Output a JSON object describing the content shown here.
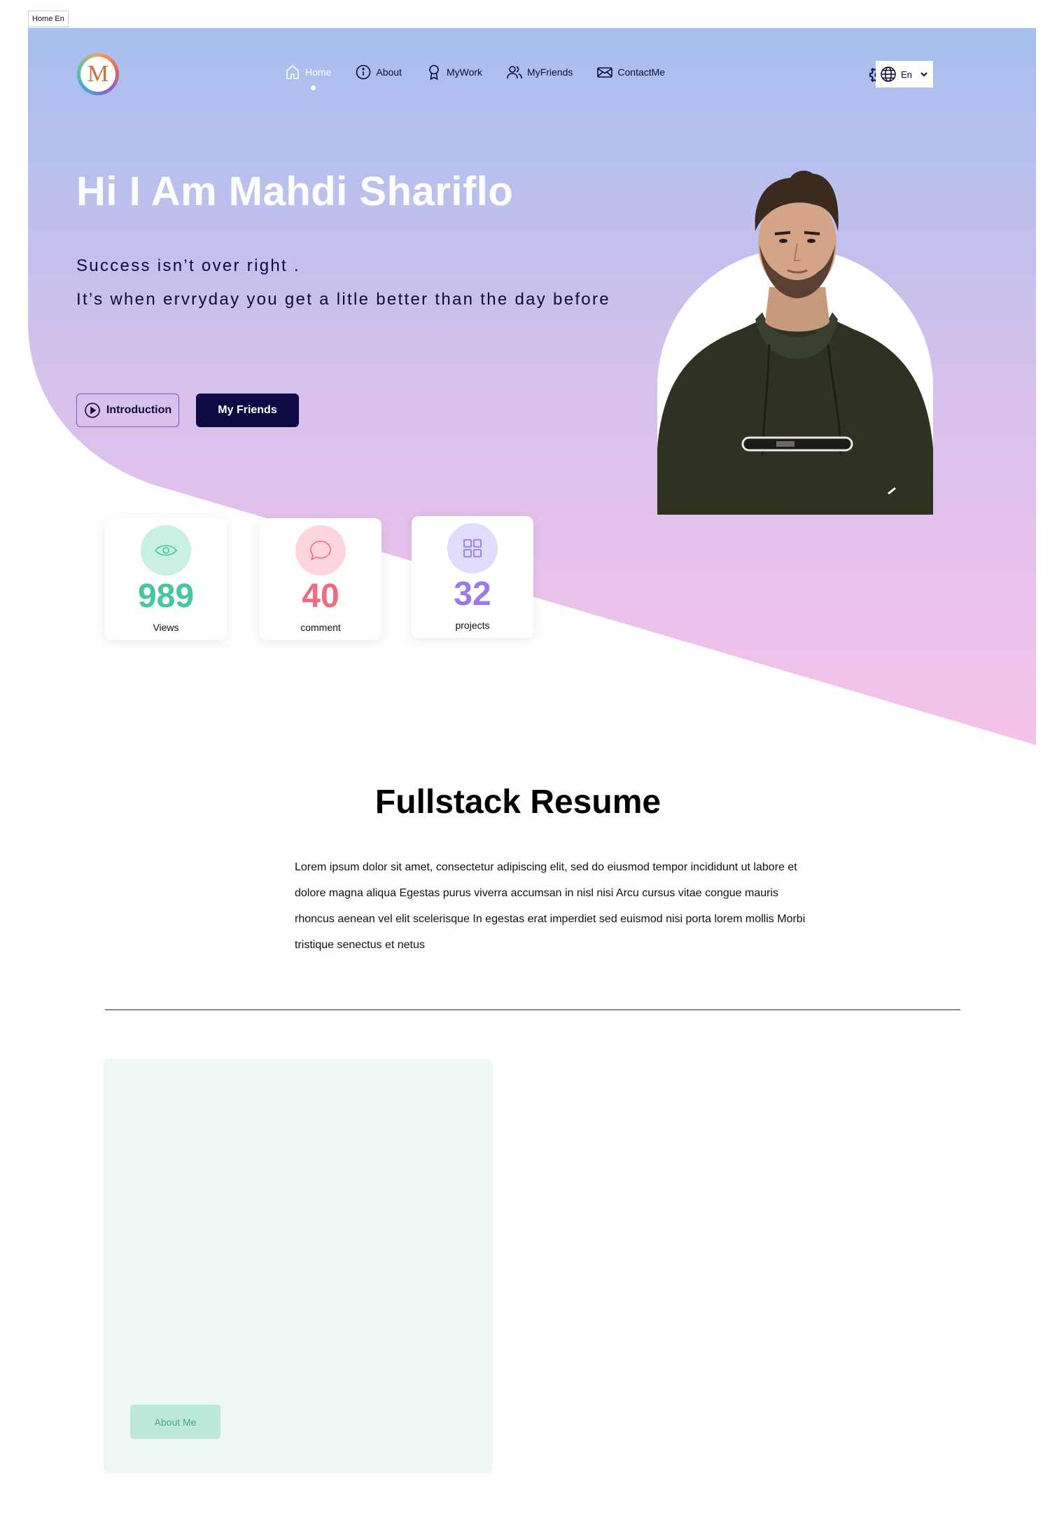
{
  "browser_tab": {
    "label": "Home En"
  },
  "header": {
    "logo_letter": "M",
    "nav": [
      {
        "label": "Home",
        "icon": "home-icon",
        "active": true
      },
      {
        "label": "About",
        "icon": "info-icon",
        "active": false
      },
      {
        "label": "MyWork",
        "icon": "award-icon",
        "active": false
      },
      {
        "label": "MyFriends",
        "icon": "users-icon",
        "active": false
      },
      {
        "label": "ContactMe",
        "icon": "mail-icon",
        "active": false
      }
    ],
    "settings_icon": "gear-icon",
    "language": {
      "value": "En",
      "icon": "globe-icon"
    }
  },
  "hero": {
    "title": "Hi I Am Mahdi Shariflo",
    "tagline_1": "Success isn’t over right .",
    "tagline_2": "It’s when ervryday you get a litle better than the day before",
    "intro_button": "Introduction",
    "friends_button": "My Friends",
    "colors": {
      "gradient_top": "#a6bfee",
      "gradient_mid": "#d6c1ec",
      "gradient_bottom": "#f6c2ea",
      "dark": "#0e0942"
    }
  },
  "stats": [
    {
      "value": "989",
      "label": "Views",
      "icon": "eye-icon",
      "color": "#43c79b",
      "bg": "#c9f0e3"
    },
    {
      "value": "40",
      "label": "comment",
      "icon": "chat-icon",
      "color": "#f06a82",
      "bg": "#fdd6dd"
    },
    {
      "value": "32",
      "label": "projects",
      "icon": "grid-icon",
      "color": "#9a79ec",
      "bg": "#e0dcfb"
    }
  ],
  "resume": {
    "title": "Fullstack Resume",
    "body": "Lorem ipsum dolor sit amet, consectetur adipiscing elit, sed do eiusmod tempor incididunt ut labore et dolore magna aliqua Egestas purus viverra accumsan in nisl nisi Arcu cursus vitae congue mauris rhoncus aenean vel elit scelerisque In egestas erat imperdiet sed euismod nisi porta lorem mollis Morbi tristique senectus et netus"
  },
  "about": {
    "button": "About Me"
  }
}
